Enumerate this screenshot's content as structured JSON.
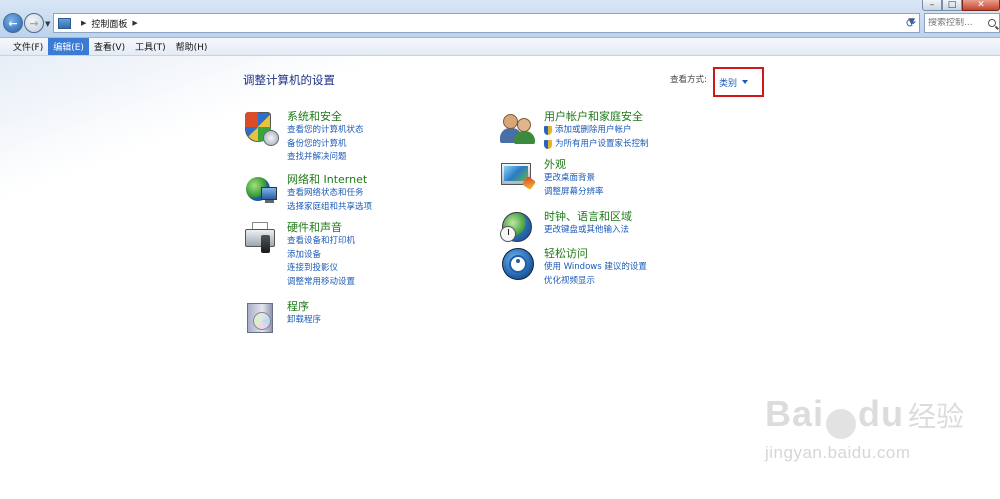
{
  "address_bar": {
    "breadcrumbs": [
      "控制面板"
    ],
    "search_placeholder": "搜索控制..."
  },
  "menubar": [
    {
      "label": "文件(F)",
      "active": false
    },
    {
      "label": "编辑(E)",
      "active": true
    },
    {
      "label": "查看(V)",
      "active": false
    },
    {
      "label": "工具(T)",
      "active": false
    },
    {
      "label": "帮助(H)",
      "active": false
    }
  ],
  "main": {
    "title": "调整计算机的设置",
    "view_by_label": "查看方式:",
    "view_by_value": "类别"
  },
  "categories_left": [
    {
      "icon": "security-shield-icon",
      "title": "系统和安全",
      "links": [
        "查看您的计算机状态",
        "备份您的计算机",
        "查找并解决问题"
      ]
    },
    {
      "icon": "network-globe-icon",
      "title": "网络和 Internet",
      "links": [
        "查看网络状态和任务",
        "选择家庭组和共享选项"
      ]
    },
    {
      "icon": "printer-speaker-icon",
      "title": "硬件和声音",
      "links": [
        "查看设备和打印机",
        "添加设备",
        "连接到投影仪",
        "调整常用移动设置"
      ]
    },
    {
      "icon": "programs-disc-icon",
      "title": "程序",
      "links": [
        "卸载程序"
      ]
    }
  ],
  "categories_right": [
    {
      "icon": "users-icon",
      "title": "用户帐户和家庭安全",
      "links": [
        "添加或删除用户帐户",
        "为所有用户设置家长控制"
      ],
      "shield_links": true
    },
    {
      "icon": "monitor-brush-icon",
      "title": "外观",
      "links": [
        "更改桌面背景",
        "调整屏幕分辨率"
      ]
    },
    {
      "icon": "globe-clock-icon",
      "title": "时钟、语言和区域",
      "links": [
        "更改键盘或其他输入法"
      ]
    },
    {
      "icon": "ease-of-access-icon",
      "title": "轻松访问",
      "links": [
        "使用 Windows 建议的设置",
        "优化视频显示"
      ]
    }
  ],
  "watermark": {
    "brand_left": "Bai",
    "brand_right": "du",
    "brand_cn": "经验",
    "url": "jingyan.baidu.com"
  },
  "colors": {
    "accent_link": "#1c5bb8",
    "category_title": "#1f7a18",
    "highlight_box": "#d01818",
    "menu_active": "#3b7bd4"
  }
}
